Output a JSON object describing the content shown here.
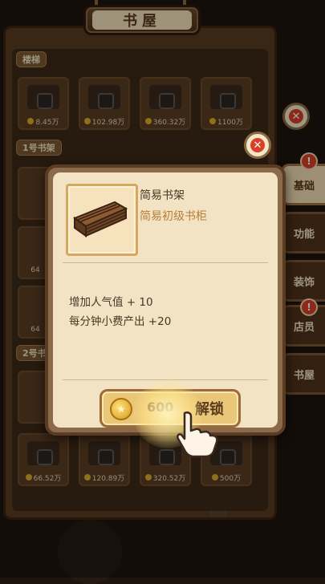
{
  "header": {
    "title": "书屋"
  },
  "sections": [
    {
      "label": "楼梯",
      "prices": [
        "8.45万",
        "102.98万",
        "360.32万",
        "1100万"
      ]
    },
    {
      "label": "1号书架"
    },
    {
      "label": "2号书"
    },
    {
      "label": "",
      "prices": [
        "66.52万",
        "120.89万",
        "320.52万",
        "500万"
      ]
    }
  ],
  "side_tabs": [
    "基础",
    "功能",
    "装饰",
    "店员",
    "书屋"
  ],
  "popup": {
    "item_name": "简易书架",
    "item_desc": "简易初级书柜",
    "effects": [
      "增加人气值 + 10",
      "每分钟小费产出 +20"
    ],
    "unlock_price": "600",
    "unlock_label": "解锁",
    "close_symbol": "✕"
  },
  "partial_prices": [
    "64",
    "64"
  ],
  "colors": {
    "accent": "#d9402a",
    "gold": "#e9c678",
    "panel": "#f2e3c5"
  }
}
